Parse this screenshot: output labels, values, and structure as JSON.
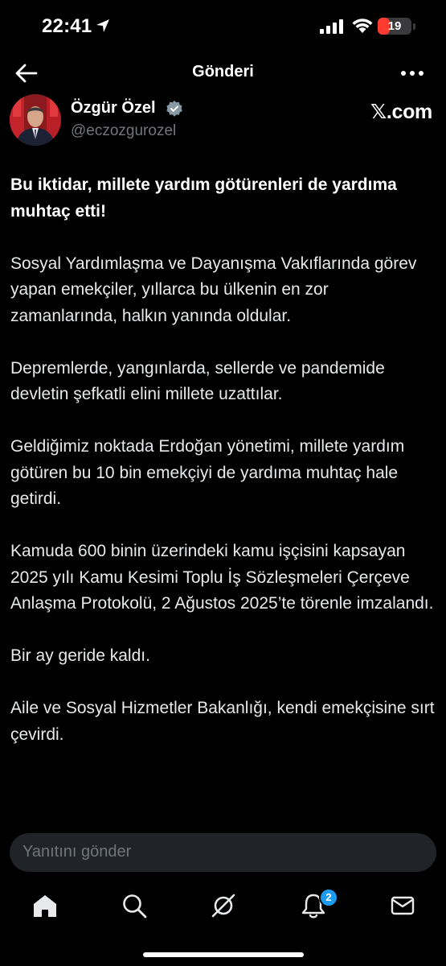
{
  "status_bar": {
    "time": "22:41",
    "battery_level": "19",
    "battery_fraction": 0.19,
    "battery_color": "#ff3b30"
  },
  "nav": {
    "title": "Gönderi",
    "back_icon": "arrow-left-icon",
    "more_icon": "more-horizontal-icon"
  },
  "author": {
    "name": "Özgür Özel",
    "handle": "@eczozgurozel",
    "verified_badge_color": "#8899a6",
    "source": "𝕏.com"
  },
  "tweet": {
    "headline": "Bu iktidar, millete yardım götürenleri de yardıma muhtaç etti!",
    "paragraphs": [
      "Sosyal Yardımlaşma ve Dayanışma Vakıflarında görev yapan emekçiler, yıllarca bu ülkenin en zor zamanlarında, halkın yanında oldular.",
      "Depremlerde, yangınlarda, sellerde ve pandemide devletin şefkatli elini millete uzattılar.",
      "Geldiğimiz noktada Erdoğan yönetimi, millete yardım götüren bu 10 bin emekçiyi de yardıma muhtaç hale getirdi.",
      "Kamuda 600 binin üzerindeki kamu işçisini kapsayan 2025 yılı Kamu Kesimi Toplu İş Sözleşmeleri Çerçeve Anlaşma Protokolü, 2 Ağustos 2025’te törenle imzalandı.",
      "Bir ay geride kaldı.",
      "Aile ve Sosyal Hizmetler Bakanlığı, kendi emekçisine sırt çevirdi."
    ]
  },
  "reply": {
    "placeholder": "Yanıtını gönder"
  },
  "tabbar": {
    "items": [
      "home-icon",
      "search-icon",
      "grok-icon",
      "notifications-icon",
      "messages-icon"
    ],
    "notification_count": "2",
    "badge_color": "#1d9bf0"
  }
}
